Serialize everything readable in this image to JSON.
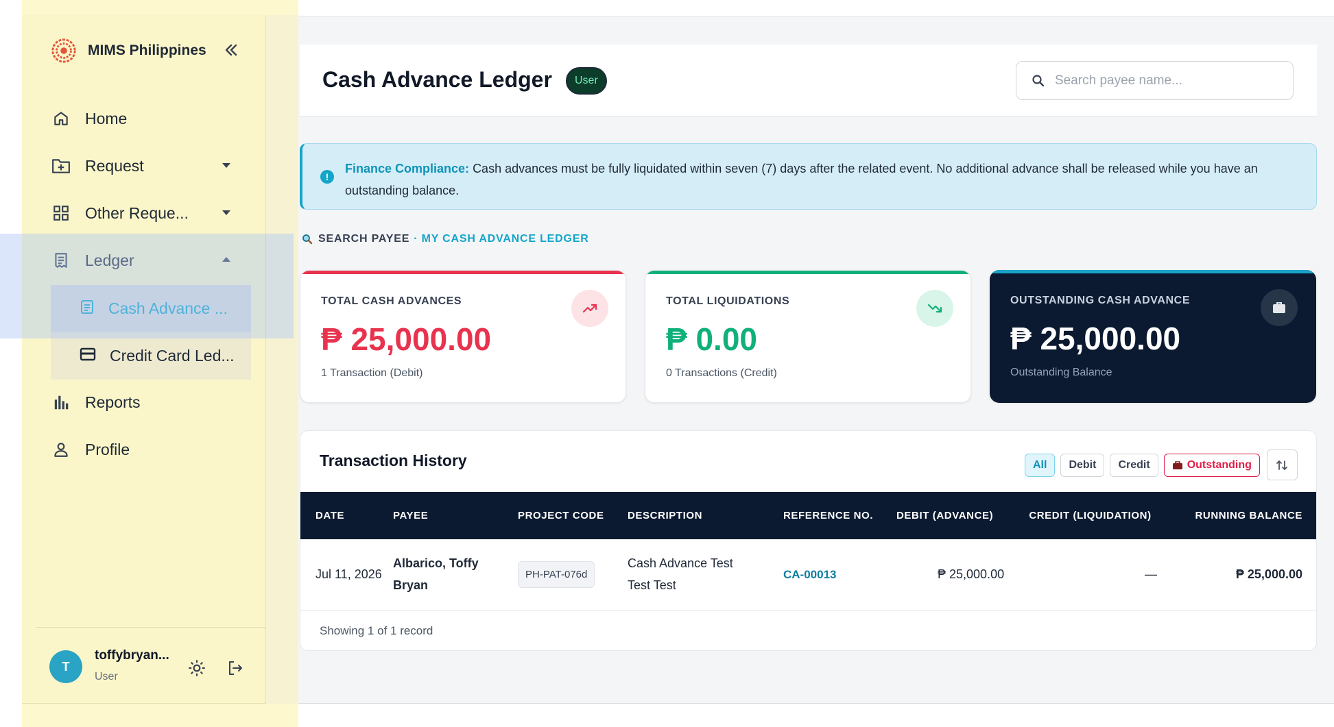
{
  "sidebar": {
    "brand": "MIMS Philippines",
    "nav": [
      {
        "label": "Home",
        "icon": "home-icon"
      },
      {
        "label": "Request",
        "icon": "folder-plus-icon"
      },
      {
        "label": "Other Reque...",
        "icon": "grid-icon"
      },
      {
        "label": "Ledger",
        "icon": "receipt-icon"
      }
    ],
    "ledger_sub": [
      {
        "label": "Cash Advance ...",
        "icon": "document-icon",
        "active": true
      },
      {
        "label": "Credit Card Led...",
        "icon": "credit-card-icon",
        "active": false
      }
    ],
    "nav_bottom": [
      {
        "label": "Reports",
        "icon": "bar-chart-icon"
      },
      {
        "label": "Profile",
        "icon": "user-icon"
      }
    ],
    "user": {
      "initial": "T",
      "name": "toffybryan...",
      "role": "User"
    }
  },
  "header": {
    "title": "Cash Advance Ledger",
    "role_badge": "User",
    "search_placeholder": "Search payee name..."
  },
  "alert": {
    "title": "Finance Compliance:",
    "message": "Cash advances must be fully liquidated within seven (7) days after the related event. No additional advance shall be released while you have an outstanding balance."
  },
  "section": {
    "label": "SEARCH PAYEE",
    "sublabel": "· MY CASH ADVANCE LEDGER"
  },
  "cards": [
    {
      "label": "TOTAL CASH ADVANCES",
      "value": "₱ 25,000.00",
      "sub": "1 Transaction (Debit)",
      "color": "#e8334f"
    },
    {
      "label": "TOTAL LIQUIDATIONS",
      "value": "₱ 0.00",
      "sub": "0 Transactions (Credit)",
      "color": "#10b07a"
    },
    {
      "label": "OUTSTANDING CASH ADVANCE",
      "value": "₱ 25,000.00",
      "sub": "Outstanding Balance",
      "color": "#1aa3c8"
    }
  ],
  "history": {
    "title": "Transaction History",
    "filters": [
      "All",
      "Debit",
      "Credit",
      "Outstanding"
    ],
    "columns": [
      "DATE",
      "PAYEE",
      "PROJECT CODE",
      "DESCRIPTION",
      "REFERENCE NO.",
      "DEBIT (ADVANCE)",
      "CREDIT (LIQUIDATION)",
      "RUNNING BALANCE"
    ],
    "rows": [
      {
        "date": "Jul 11, 2026",
        "payee": "Albarico, Toffy Bryan",
        "project_code": "PH-PAT-076d",
        "description": "Cash Advance Test Test Test",
        "reference": "CA-00013",
        "debit": "₱ 25,000.00",
        "credit": "—",
        "balance": "₱ 25,000.00"
      }
    ],
    "footer": "Showing 1 of 1 record"
  }
}
